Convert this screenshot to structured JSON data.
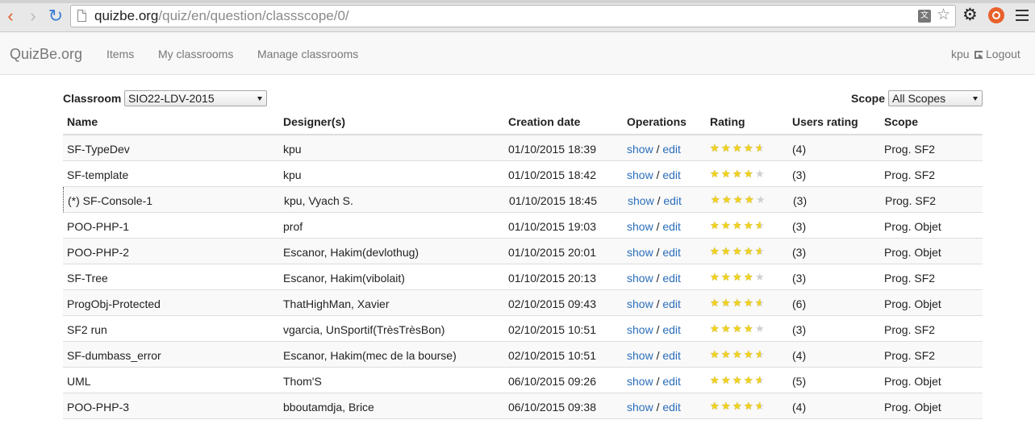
{
  "browser": {
    "url_domain": "quizbe.org",
    "url_path": "/quiz/en/question/classscope/0/"
  },
  "navbar": {
    "brand": "QuizBe.org",
    "links": [
      "Items",
      "My classrooms",
      "Manage classrooms"
    ],
    "user": "kpu",
    "logout": "Logout"
  },
  "filters": {
    "classroom_label": "Classroom",
    "classroom_value": "SIO22-LDV-2015",
    "scope_label": "Scope",
    "scope_value": "All Scopes"
  },
  "table": {
    "headers": [
      "Name",
      "Designer(s)",
      "Creation date",
      "Operations",
      "Rating",
      "Users rating",
      "Scope"
    ],
    "show_label": "show",
    "separator": "/",
    "edit_label": "edit",
    "rows": [
      {
        "name": "SF-TypeDev",
        "designers": "kpu",
        "date": "01/10/2015 18:39",
        "rating": 4.5,
        "users": "(4)",
        "scope": "Prog. SF2"
      },
      {
        "name": "SF-template",
        "designers": "kpu",
        "date": "01/10/2015 18:42",
        "rating": 4,
        "users": "(3)",
        "scope": "Prog. SF2"
      },
      {
        "name": "(*) SF-Console-1",
        "designers": "kpu, Vyach S.",
        "date": "01/10/2015 18:45",
        "rating": 4,
        "users": "(3)",
        "scope": "Prog. SF2"
      },
      {
        "name": "POO-PHP-1",
        "designers": "prof",
        "date": "01/10/2015 19:03",
        "rating": 4.5,
        "users": "(3)",
        "scope": "Prog. Objet"
      },
      {
        "name": "POO-PHP-2",
        "designers": "Escanor, Hakim(devlothug)",
        "date": "01/10/2015 20:01",
        "rating": 4.5,
        "users": "(3)",
        "scope": "Prog. Objet"
      },
      {
        "name": "SF-Tree",
        "designers": "Escanor, Hakim(vibolait)",
        "date": "01/10/2015 20:13",
        "rating": 4,
        "users": "(3)",
        "scope": "Prog. SF2"
      },
      {
        "name": "ProgObj-Protected",
        "designers": "ThatHighMan, Xavier",
        "date": "02/10/2015 09:43",
        "rating": 4.5,
        "users": "(6)",
        "scope": "Prog. Objet"
      },
      {
        "name": "SF2 run",
        "designers": "vgarcia, UnSportif(TrèsTrèsBon)",
        "date": "02/10/2015 10:51",
        "rating": 4,
        "users": "(3)",
        "scope": "Prog. SF2"
      },
      {
        "name": "SF-dumbass_error",
        "designers": "Escanor, Hakim(mec de la bourse)",
        "date": "02/10/2015 10:51",
        "rating": 4.5,
        "users": "(4)",
        "scope": "Prog. SF2"
      },
      {
        "name": "UML",
        "designers": "Thom'S",
        "date": "06/10/2015 09:26",
        "rating": 4.5,
        "users": "(5)",
        "scope": "Prog. Objet"
      },
      {
        "name": "POO-PHP-3",
        "designers": "bboutamdja, Brice",
        "date": "06/10/2015 09:38",
        "rating": 4.5,
        "users": "(4)",
        "scope": "Prog. Objet"
      }
    ]
  }
}
